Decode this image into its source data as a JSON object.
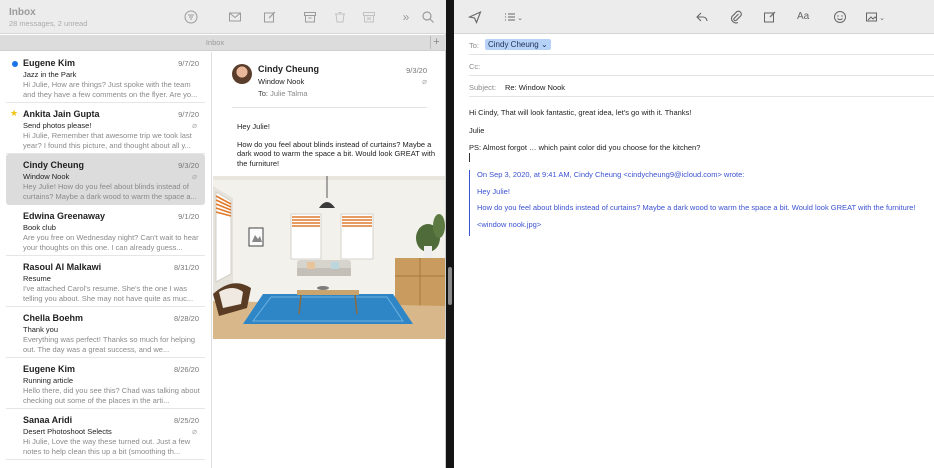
{
  "left": {
    "mailbox_title": "Inbox",
    "mailbox_subtitle": "28 messages, 2 unread",
    "filter_label": "Inbox",
    "messages": [
      {
        "from": "Eugene Kim",
        "date": "9/7/20",
        "subject": "Jazz in the Park",
        "preview": "Hi Julie, How are things? Just spoke with the team and they have a few comments on the flyer. Are yo...",
        "unread": true
      },
      {
        "from": "Ankita Jain Gupta",
        "date": "9/7/20",
        "subject": "Send photos please!",
        "preview": "Hi Julie, Remember that awesome trip we took last year? I found this picture, and thought about all y...",
        "flagged": true,
        "attachment": true
      },
      {
        "from": "Cindy Cheung",
        "date": "9/3/20",
        "subject": "Window Nook",
        "preview": "Hey Julie! How do you feel about blinds instead of curtains? Maybe a dark wood to warm the space a...",
        "selected": true,
        "attachment": true
      },
      {
        "from": "Edwina Greenaway",
        "date": "9/1/20",
        "subject": "Book club",
        "preview": "Are you free on Wednesday night? Can't wait to hear your thoughts on this one. I can already guess..."
      },
      {
        "from": "Rasoul Al Malkawi",
        "date": "8/31/20",
        "subject": "Resume",
        "preview": "I've attached Carol's resume. She's the one I was telling you about. She may not have quite as muc..."
      },
      {
        "from": "Chella Boehm",
        "date": "8/28/20",
        "subject": "Thank you",
        "preview": "Everything was perfect! Thanks so much for helping out. The day was a great success, and we..."
      },
      {
        "from": "Eugene Kim",
        "date": "8/26/20",
        "subject": "Running article",
        "preview": "Hello there, did you see this? Chad was talking about checking out some of the places in the arti..."
      },
      {
        "from": "Sanaa Aridi",
        "date": "8/25/20",
        "subject": "Desert Photoshoot Selects",
        "preview": "Hi Julie, Love the way these turned out. Just a few notes to help clean this up a bit (smoothing th...",
        "attachment": true
      }
    ],
    "reader": {
      "from": "Cindy Cheung",
      "subject": "Window Nook",
      "to_label": "To:",
      "to_name": "Julie Talma",
      "date": "9/3/20",
      "body": [
        "Hey Julie!",
        "How do you feel about blinds instead of curtains? Maybe a dark wood to warm the space a bit. Would look GREAT with the furniture!"
      ]
    }
  },
  "compose": {
    "to_label": "To:",
    "to_value": "Cindy Cheung",
    "cc_label": "Cc:",
    "subject_label": "Subject:",
    "subject_value": "Re: Window Nook",
    "body": [
      "Hi Cindy, That will look fantastic, great idea, let's go with it. Thanks!",
      "Julie",
      "PS: Almost forgot … which paint color did you choose for the kitchen?"
    ],
    "quote": {
      "header": "On Sep 3, 2020, at 9:41 AM, Cindy Cheung <cindycheung9@icloud.com> wrote:",
      "lines": [
        "Hey Julie!",
        "How do you feel about blinds instead of curtains? Maybe a dark wood to warm the space a bit. Would look GREAT with the furniture!",
        "<window nook.jpg>"
      ]
    }
  },
  "colors": {
    "unread_dot": "#1a73e8",
    "flag": "#f1c40f",
    "quote": "#3c52d1",
    "chip": "#b7d2f7"
  }
}
